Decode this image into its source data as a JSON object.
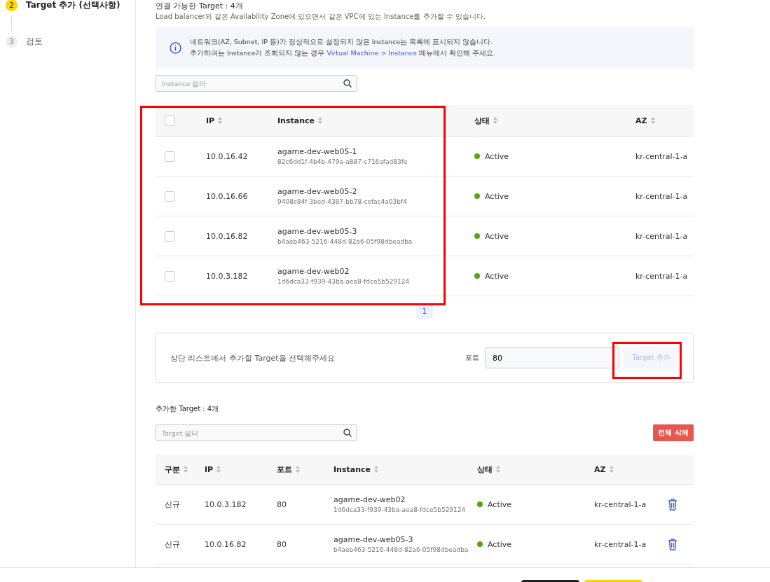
{
  "steps": [
    {
      "number": "2",
      "label": "Target 추가 (선택사항)",
      "active": true
    },
    {
      "number": "3",
      "label": "검토",
      "active": false
    }
  ],
  "available": {
    "title": "연결 가능한 Target : 4개",
    "description": "Load balancer와 같은 Availability Zone에 있으면서 같은 VPC에 있는 Instance를 추가할 수 있습니다.",
    "notice": {
      "line_1": "네트워크(AZ, Subnet, IP 등)가 정상적으로 설정되지 않은 Instance는 목록에 표시되지 않습니다.",
      "line_2_before": "추가하려는 Instance가 조회되지 않는 경우",
      "link": "Virtual Machine > Instance",
      "line_2_after": "메뉴에서 확인해 주세요."
    },
    "filter": {
      "placeholder": "Instance 필터"
    },
    "columns": [
      "IP",
      "Instance",
      "상태",
      "AZ"
    ],
    "header_checked": false,
    "rows": [
      {
        "checked": false,
        "ip": "10.0.16.42",
        "name": "agame-dev-web05-1",
        "id": "82c6dd1f-4b4b-479a-a887-c716afad83fe",
        "status": "Active",
        "az": "kr-central-1-a"
      },
      {
        "checked": false,
        "ip": "10.0.16.66",
        "name": "agame-dev-web05-2",
        "id": "9408c84f-3bed-4387-bb78-cefac4a03bf4",
        "status": "Active",
        "az": "kr-central-1-a"
      },
      {
        "checked": false,
        "ip": "10.0.16.82",
        "name": "agame-dev-web05-3",
        "id": "b4aeb463-5216-448d-82a6-05f98dbeadba",
        "status": "Active",
        "az": "kr-central-1-a"
      },
      {
        "checked": false,
        "ip": "10.0.3.182",
        "name": "agame-dev-web02",
        "id": "1d6dca33-f939-43ba-aea8-fdce5b529124",
        "status": "Active",
        "az": "kr-central-1-a"
      }
    ],
    "pages": [
      {
        "label": "1",
        "selected": true
      }
    ]
  },
  "add_panel": {
    "message": "상단 리스트에서 추가할 Target을 선택해주세요",
    "port_label": "포트",
    "port_value": "80",
    "button": "Target 추가",
    "button_disabled": true
  },
  "added": {
    "title": "추가한 Target : 4개",
    "filter": {
      "placeholder": "Target 필터"
    },
    "delete_all": "전체 삭제",
    "columns": [
      "구분",
      "IP",
      "포트",
      "Instance",
      "상태",
      "AZ"
    ],
    "rows": [
      {
        "type": "신규",
        "ip": "10.0.3.182",
        "port": "80",
        "name": "agame-dev-web02",
        "id": "1d6dca33-f939-43ba-aea8-fdce5b529124",
        "status": "Active",
        "az": "kr-central-1-a"
      },
      {
        "type": "신규",
        "ip": "10.0.16.82",
        "port": "80",
        "name": "agame-dev-web05-3",
        "id": "b4aeb463-5216-448d-82a6-05f98dbeadba",
        "status": "Active",
        "az": "kr-central-1-a"
      }
    ]
  }
}
